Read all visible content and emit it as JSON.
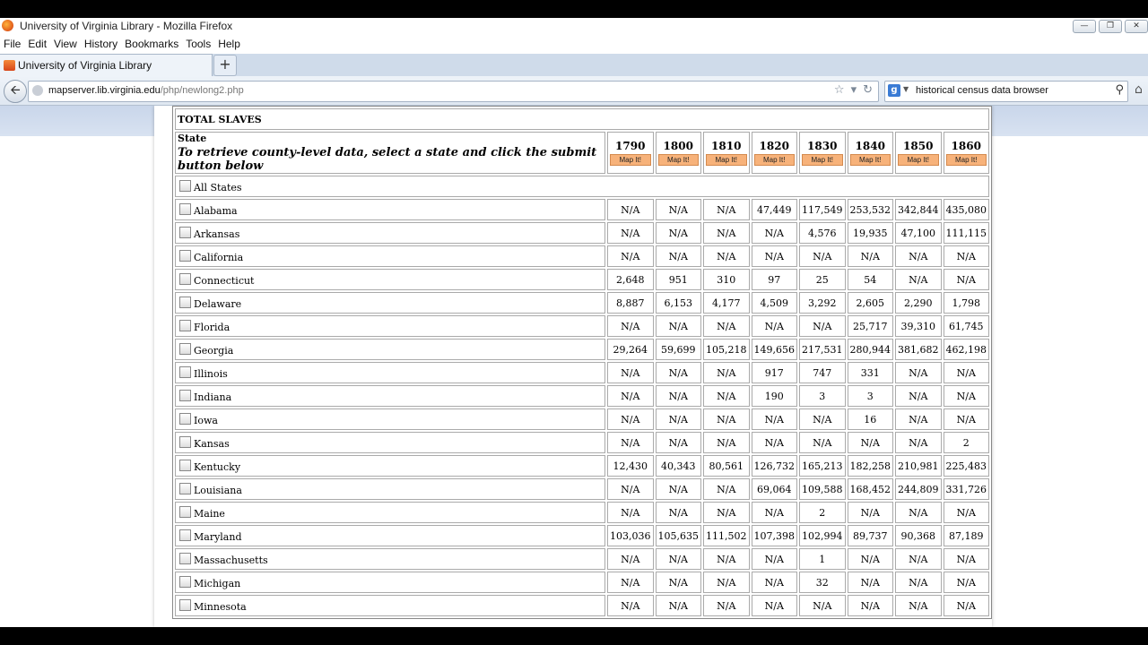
{
  "window": {
    "title": "University of Virginia Library - Mozilla Firefox"
  },
  "menu": [
    "File",
    "Edit",
    "View",
    "History",
    "Bookmarks",
    "Tools",
    "Help"
  ],
  "tab": {
    "label": "University of Virginia Library",
    "new_tab": "+"
  },
  "nav": {
    "url_host": "mapserver.lib.virginia.edu",
    "url_path": "/php/newlong2.php",
    "search_value": "historical census data browser",
    "search_engine": "g"
  },
  "table": {
    "title": "TOTAL SLAVES",
    "state_header": "State",
    "instruction": "To retrieve county-level data, select a state and click the submit button below",
    "map_label": "Map It!",
    "years": [
      "1790",
      "1800",
      "1810",
      "1820",
      "1830",
      "1840",
      "1850",
      "1860"
    ],
    "all_states": "All States",
    "rows": [
      {
        "state": "Alabama",
        "values": [
          "N/A",
          "N/A",
          "N/A",
          "47,449",
          "117,549",
          "253,532",
          "342,844",
          "435,080"
        ]
      },
      {
        "state": "Arkansas",
        "values": [
          "N/A",
          "N/A",
          "N/A",
          "N/A",
          "4,576",
          "19,935",
          "47,100",
          "111,115"
        ]
      },
      {
        "state": "California",
        "values": [
          "N/A",
          "N/A",
          "N/A",
          "N/A",
          "N/A",
          "N/A",
          "N/A",
          "N/A"
        ]
      },
      {
        "state": "Connecticut",
        "values": [
          "2,648",
          "951",
          "310",
          "97",
          "25",
          "54",
          "N/A",
          "N/A"
        ]
      },
      {
        "state": "Delaware",
        "values": [
          "8,887",
          "6,153",
          "4,177",
          "4,509",
          "3,292",
          "2,605",
          "2,290",
          "1,798"
        ]
      },
      {
        "state": "Florida",
        "values": [
          "N/A",
          "N/A",
          "N/A",
          "N/A",
          "N/A",
          "25,717",
          "39,310",
          "61,745"
        ]
      },
      {
        "state": "Georgia",
        "values": [
          "29,264",
          "59,699",
          "105,218",
          "149,656",
          "217,531",
          "280,944",
          "381,682",
          "462,198"
        ]
      },
      {
        "state": "Illinois",
        "values": [
          "N/A",
          "N/A",
          "N/A",
          "917",
          "747",
          "331",
          "N/A",
          "N/A"
        ]
      },
      {
        "state": "Indiana",
        "values": [
          "N/A",
          "N/A",
          "N/A",
          "190",
          "3",
          "3",
          "N/A",
          "N/A"
        ]
      },
      {
        "state": "Iowa",
        "values": [
          "N/A",
          "N/A",
          "N/A",
          "N/A",
          "N/A",
          "16",
          "N/A",
          "N/A"
        ]
      },
      {
        "state": "Kansas",
        "values": [
          "N/A",
          "N/A",
          "N/A",
          "N/A",
          "N/A",
          "N/A",
          "N/A",
          "2"
        ]
      },
      {
        "state": "Kentucky",
        "values": [
          "12,430",
          "40,343",
          "80,561",
          "126,732",
          "165,213",
          "182,258",
          "210,981",
          "225,483"
        ]
      },
      {
        "state": "Louisiana",
        "values": [
          "N/A",
          "N/A",
          "N/A",
          "69,064",
          "109,588",
          "168,452",
          "244,809",
          "331,726"
        ]
      },
      {
        "state": "Maine",
        "values": [
          "N/A",
          "N/A",
          "N/A",
          "N/A",
          "2",
          "N/A",
          "N/A",
          "N/A"
        ]
      },
      {
        "state": "Maryland",
        "values": [
          "103,036",
          "105,635",
          "111,502",
          "107,398",
          "102,994",
          "89,737",
          "90,368",
          "87,189"
        ]
      },
      {
        "state": "Massachusetts",
        "values": [
          "N/A",
          "N/A",
          "N/A",
          "N/A",
          "1",
          "N/A",
          "N/A",
          "N/A"
        ]
      },
      {
        "state": "Michigan",
        "values": [
          "N/A",
          "N/A",
          "N/A",
          "N/A",
          "32",
          "N/A",
          "N/A",
          "N/A"
        ]
      },
      {
        "state": "Minnesota",
        "values": [
          "N/A",
          "N/A",
          "N/A",
          "N/A",
          "N/A",
          "N/A",
          "N/A",
          "N/A"
        ]
      }
    ]
  }
}
